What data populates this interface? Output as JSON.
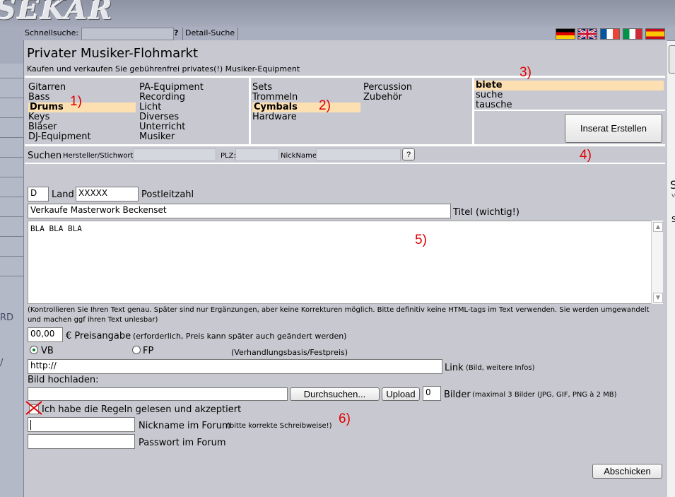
{
  "header": {
    "logo_text": "SEKAR",
    "quick_search_label": "Schnellsuche:",
    "quick_search_help": "?",
    "detail_search_label": "Detail-Suche",
    "flags": [
      {
        "name": "flag-de-icon",
        "colors": [
          "#000000",
          "#dd0000",
          "#ffce00"
        ]
      },
      {
        "name": "flag-uk-icon",
        "colors": [
          "#012169",
          "#ffffff",
          "#c8102e"
        ]
      },
      {
        "name": "flag-fr-icon",
        "colors": [
          "#0055a4",
          "#ffffff",
          "#ef4135"
        ]
      },
      {
        "name": "flag-it-icon",
        "colors": [
          "#009246",
          "#ffffff",
          "#ce2b37"
        ]
      },
      {
        "name": "flag-es-icon",
        "colors": [
          "#c60b1e",
          "#ffc400",
          "#c60b1e"
        ]
      }
    ]
  },
  "sidebar": {
    "text_1": "RD",
    "text_2": "/"
  },
  "right": {
    "text_1": "S",
    "text_2": "v",
    "text_3": "S"
  },
  "page": {
    "title": "Privater Musiker-Flohmarkt",
    "subtitle": "Kaufen und verkaufen Sie gebührenfrei privates(!) Musiker-Equipment"
  },
  "categories": {
    "col1": [
      "Gitarren",
      "Bass",
      "Drums",
      "Keys",
      "Bläser",
      "DJ-Equipment"
    ],
    "col2": [
      "PA-Equipment",
      "Recording",
      "Licht",
      "Diverses",
      "Unterricht",
      "Musiker"
    ],
    "selected_index": 2
  },
  "subcategories": {
    "col1": [
      "Sets",
      "Trommeln",
      "Cymbals",
      "Hardware"
    ],
    "col2": [
      "Percussion",
      "Zubehör"
    ],
    "selected_index": 2
  },
  "offer_type": {
    "options": [
      "biete",
      "suche",
      "tausche"
    ],
    "selected_index": 0,
    "create_button": "Inserat Erstellen"
  },
  "annotations": [
    "1)",
    "2)",
    "3)",
    "4)",
    "5)",
    "6)"
  ],
  "search_row": {
    "label": "Suchen",
    "manufacturer_label": "Hersteller/Stichwort:",
    "zip_label": "PLZ:",
    "nick_label": "NickName:",
    "help": "?"
  },
  "form": {
    "country_value": "D",
    "country_label": "Land",
    "zip_value": "XXXXX",
    "zip_label": "Postleitzahl",
    "title_value": "Verkaufe Masterwork Beckenset",
    "title_label": "Titel (wichtig!)",
    "body_value": "BLA BLA BLA",
    "notice": "(Kontrollieren Sie Ihren Text genau. Später sind nur Ergänzungen, aber keine Korrekturen möglich. Bitte definitiv keine HTML-tags im Text verwenden. Sie werden umgewandelt und machen ggf ihren Text unlesbar)",
    "price_value": "00,00",
    "price_label": "€ Preisangabe",
    "price_hint": "(erforderlich, Preis kann später auch geändert werden)",
    "vb_label": "VB",
    "fp_label": "FP",
    "vb_fp_hint": "(Verhandlungsbasis/Festpreis)",
    "vb_selected": true,
    "link_value": "http://",
    "link_label": "Link",
    "link_hint": "(Bild, weitere Infos)",
    "upload_label": "Bild hochladen:",
    "browse_button": "Durchsuchen...",
    "upload_button": "Upload",
    "images_count": "0",
    "images_label": "Bilder",
    "images_hint": "(maximal 3 Bilder (JPG, GIF, PNG à 2 MB)",
    "rules_label": "Ich habe die Regeln gelesen und akzeptiert",
    "nickname_label": "Nickname im Forum",
    "nickname_hint": "(bitte korrekte Schreibweise!)",
    "password_label": "Passwort im Forum",
    "submit_button": "Abschicken"
  }
}
